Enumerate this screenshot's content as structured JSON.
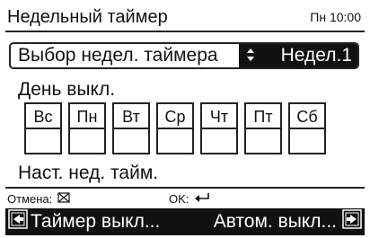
{
  "header": {
    "title": "Недельный таймер",
    "clock": "Пн 10:00"
  },
  "selector": {
    "label": "Выбор недел. таймера",
    "value": "Недел.1",
    "updown_icon": "updown-arrows-icon"
  },
  "day_off": {
    "label": "День выкл.",
    "days": [
      "Вс",
      "Пн",
      "Вт",
      "Ср",
      "Чт",
      "Пт",
      "Сб"
    ]
  },
  "current": {
    "label": "Наст. нед. тайм."
  },
  "hints": {
    "cancel_label": "Отмена:",
    "cancel_icon": "cancel-cross-icon",
    "ok_label": "OK:",
    "ok_icon": "enter-return-icon"
  },
  "bottom_bar": {
    "left_label": "Таймер выкл...",
    "left_icon": "nav-left-icon",
    "right_label": "Автом. выкл...",
    "right_icon": "nav-right-icon"
  }
}
